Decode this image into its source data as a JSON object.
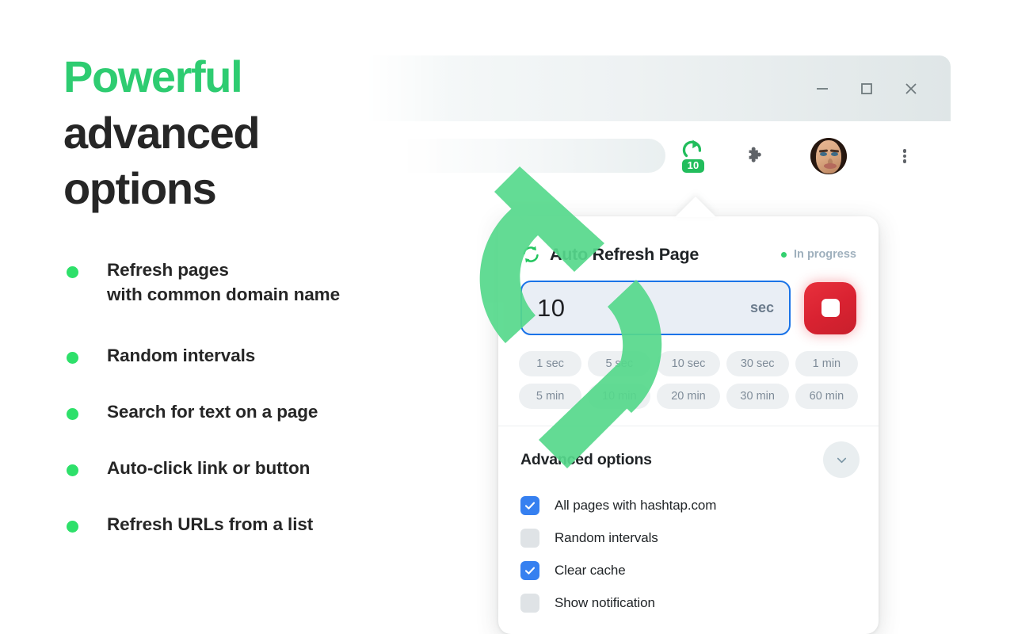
{
  "marketing": {
    "headline_line1": "Powerful",
    "headline_line2": "advanced",
    "headline_line3": "options",
    "accent_color": "#2ecc71",
    "features": [
      {
        "line1": "Refresh pages",
        "line2": "with common domain name"
      },
      {
        "line1": "Random intervals",
        "line2": ""
      },
      {
        "line1": "Search for text on a page",
        "line2": ""
      },
      {
        "line1": "Auto-click link or button",
        "line2": ""
      },
      {
        "line1": "Refresh URLs from a list",
        "line2": ""
      }
    ]
  },
  "browser": {
    "window_controls": {
      "minimize": "—",
      "maximize": "□",
      "close": "×"
    },
    "omnibox": {
      "value": "",
      "placeholder": ""
    },
    "toolbar": {
      "extension_badge": "10",
      "extensions_label": "Extensions",
      "profile_label": "Profile",
      "menu_label": "Customize and control"
    }
  },
  "popup": {
    "title": "Auto Refresh Page",
    "status": {
      "text": "In progress",
      "dot_color": "#33d06f"
    },
    "interval": {
      "value": "10",
      "unit": "sec",
      "border_color": "#1a73e8"
    },
    "stop_button": {
      "label": "Stop",
      "color": "#d92231"
    },
    "presets": [
      "1 sec",
      "5 sec",
      "10 sec",
      "30 sec",
      "1 min",
      "5 min",
      "10 min",
      "20 min",
      "30 min",
      "60 min"
    ],
    "advanced": {
      "title": "Advanced options",
      "toggle_icon": "chevron-down-icon",
      "options": [
        {
          "label": "All pages with hashtap.com",
          "checked": true
        },
        {
          "label": "Random intervals",
          "checked": false
        },
        {
          "label": "Clear cache",
          "checked": true
        },
        {
          "label": "Show notification",
          "checked": false
        }
      ]
    }
  },
  "overlay": {
    "icon": "sync-arrows-icon",
    "color": "#5fd990"
  }
}
